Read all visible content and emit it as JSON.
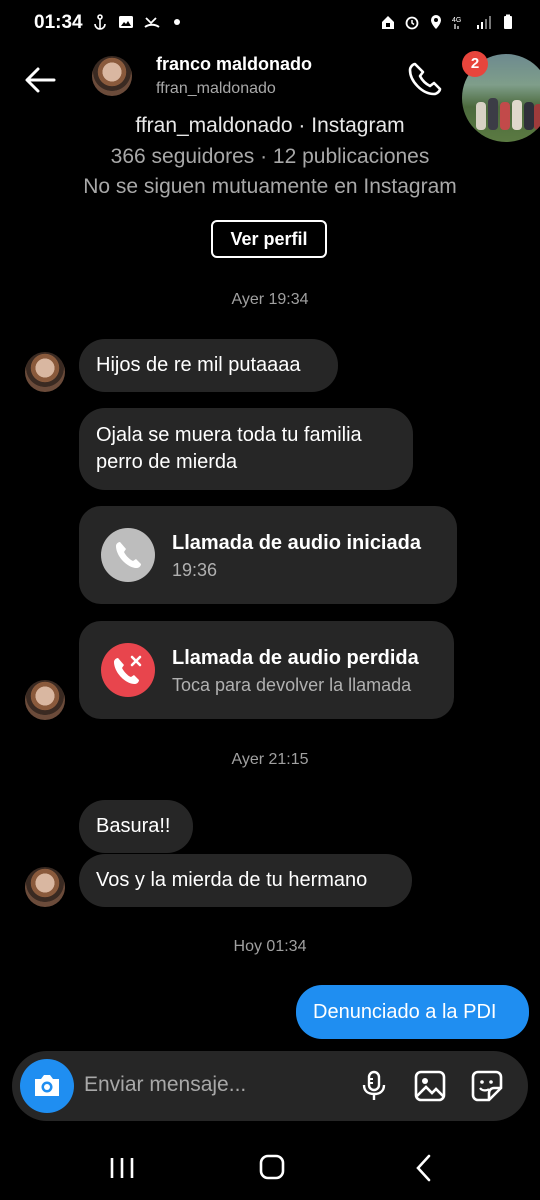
{
  "status_bar": {
    "time": "01:34"
  },
  "header": {
    "name": "franco maldonado",
    "username": "ffran_maldonado",
    "chathead_badge": "2"
  },
  "profile": {
    "title": "ffran_maldonado · Instagram",
    "stats": "366 seguidores · 12 publicaciones",
    "mutual": "No se siguen mutuamente en Instagram",
    "view_profile_label": "Ver perfil"
  },
  "timestamps": [
    "Ayer 19:34",
    "Ayer 21:15",
    "Hoy 01:34"
  ],
  "messages": {
    "m1": "Hijos de re mil putaaaa",
    "m2_line1": "Ojala se muera toda tu familia",
    "m2_line2": "perro de mierda",
    "call1_title": "Llamada de audio iniciada",
    "call1_sub": "19:36",
    "call2_title": "Llamada de audio perdida",
    "call2_sub": "Toca para devolver la llamada",
    "m3": "Basura!!",
    "m4": "Vos y la mierda de tu hermano",
    "mine1": "Denunciado a la PDI"
  },
  "composer": {
    "placeholder": "Enviar mensaje..."
  },
  "colors": {
    "accent": "#1f8ef1",
    "bubble": "#262626",
    "missed": "#e8454d",
    "background": "#000000"
  }
}
